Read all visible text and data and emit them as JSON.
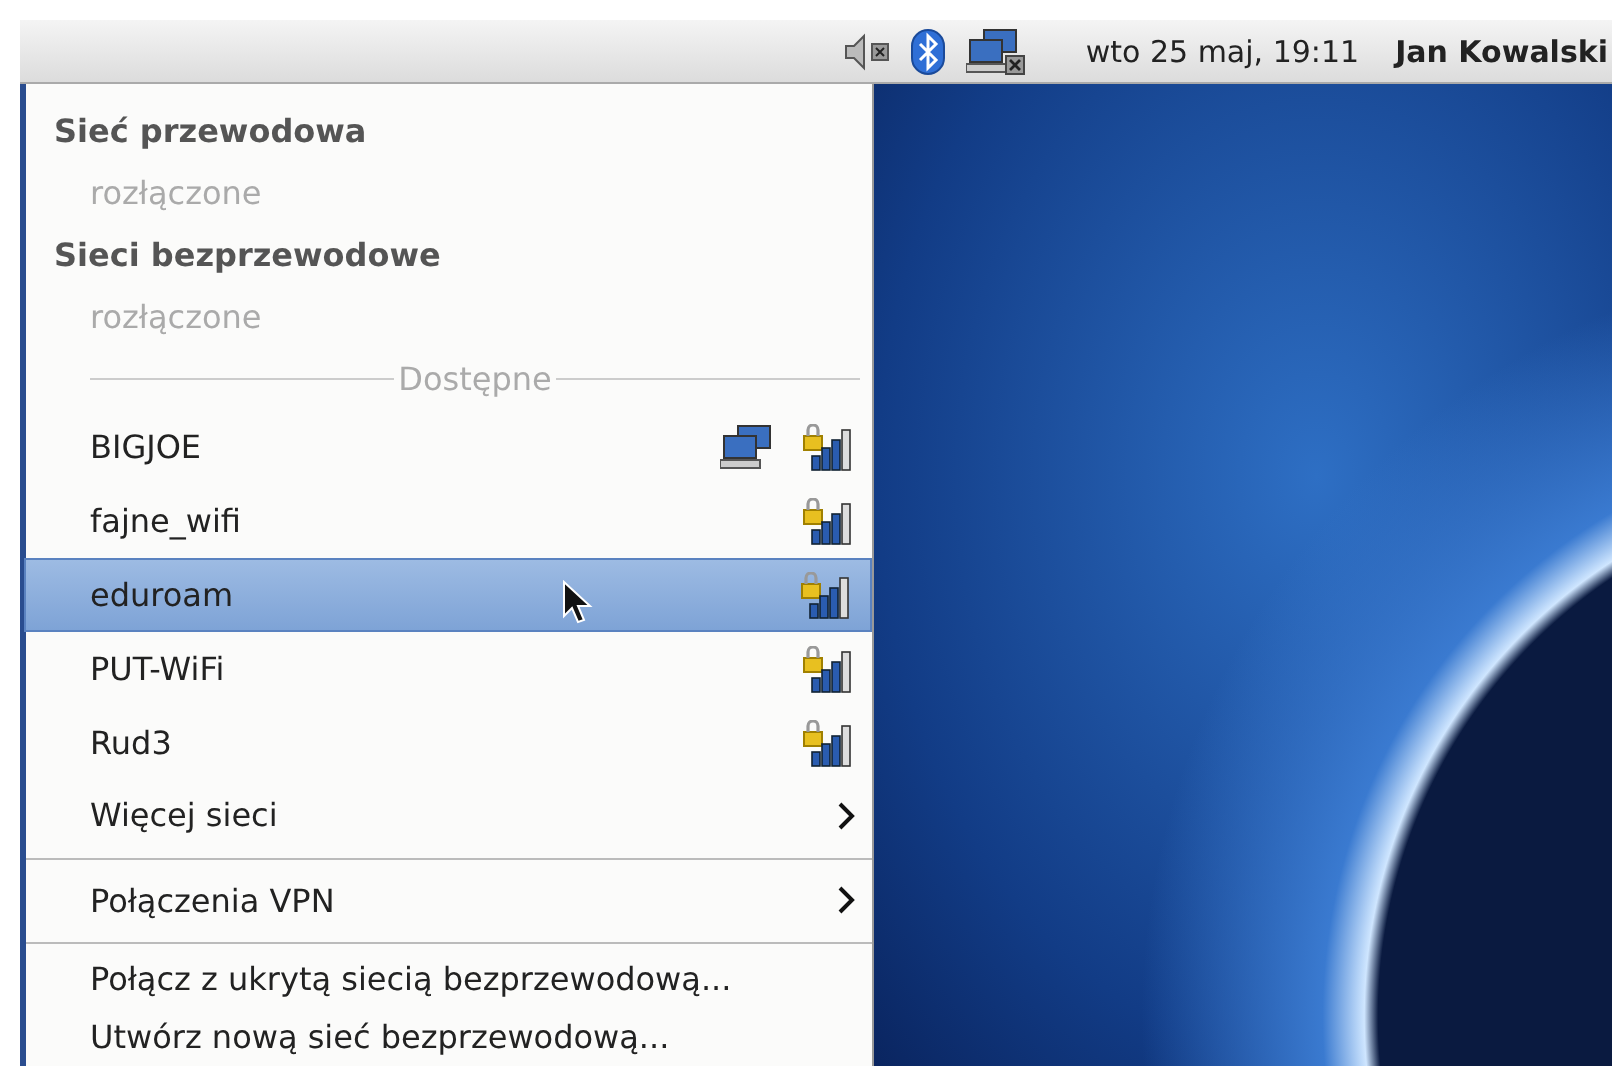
{
  "top_panel": {
    "clock": "wto 25 maj, 19:11",
    "user": "Jan Kowalski"
  },
  "menu": {
    "sections": [
      {
        "title": "Sieć przewodowa",
        "status": "rozłączone"
      },
      {
        "title": "Sieci bezprzewodowe",
        "status": "rozłączone"
      }
    ],
    "available_label": "Dostępne",
    "groups": [
      {
        "items": [
          {
            "kind": "network",
            "label": "BIGJOE",
            "adhoc": true,
            "selected": false
          },
          {
            "kind": "network",
            "label": "fajne_wifi",
            "adhoc": false,
            "selected": false
          },
          {
            "kind": "network",
            "label": "eduroam",
            "adhoc": false,
            "selected": true
          },
          {
            "kind": "network",
            "label": "PUT-WiFi",
            "adhoc": false,
            "selected": false
          },
          {
            "kind": "network",
            "label": "Rud3",
            "adhoc": false,
            "selected": false
          },
          {
            "kind": "submenu",
            "label": "Więcej sieci",
            "selected": false
          }
        ]
      },
      {
        "items": [
          {
            "kind": "submenu",
            "label": "Połączenia VPN",
            "selected": false
          }
        ]
      },
      {
        "items": [
          {
            "kind": "action",
            "label": "Połącz z ukrytą siecią bezprzewodową...",
            "selected": false
          },
          {
            "kind": "action",
            "label": "Utwórz nową sieć bezprzewodową...",
            "selected": false
          }
        ]
      }
    ]
  }
}
